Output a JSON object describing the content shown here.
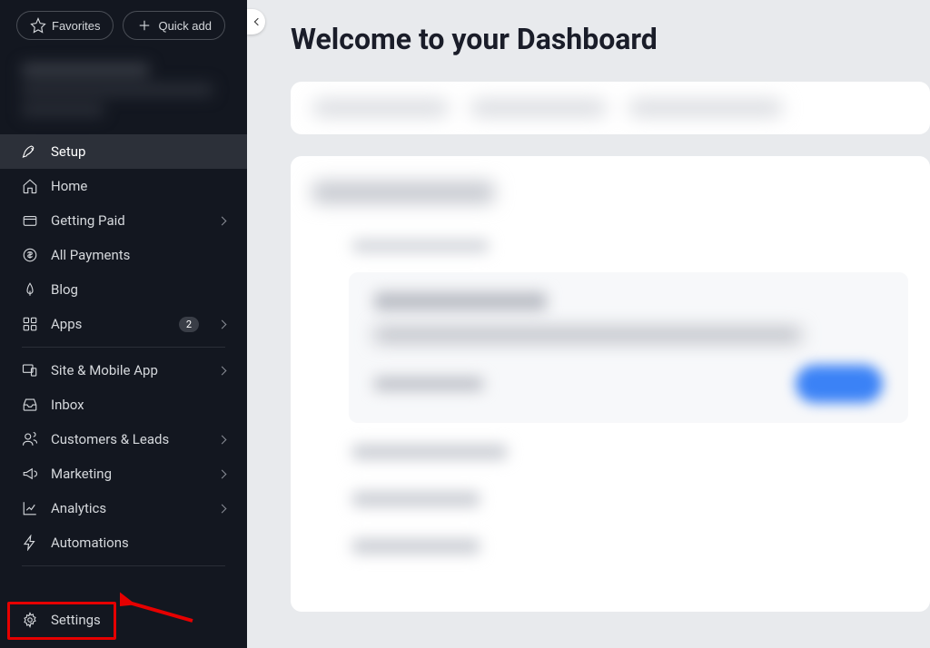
{
  "top": {
    "favorites_label": "Favorites",
    "quick_add_label": "Quick add"
  },
  "nav": {
    "setup": "Setup",
    "home": "Home",
    "getting_paid": "Getting Paid",
    "all_payments": "All Payments",
    "blog": "Blog",
    "apps": "Apps",
    "apps_badge": "2",
    "site_mobile": "Site & Mobile App",
    "inbox": "Inbox",
    "customers_leads": "Customers & Leads",
    "marketing": "Marketing",
    "analytics": "Analytics",
    "automations": "Automations",
    "settings": "Settings"
  },
  "main": {
    "title": "Welcome to your Dashboard"
  }
}
